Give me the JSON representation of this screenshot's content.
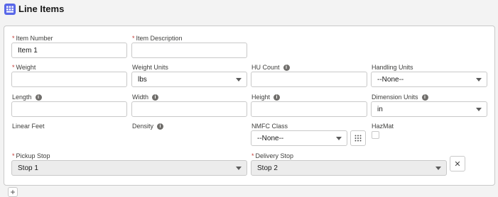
{
  "header": {
    "title": "Line Items",
    "icon": "list-icon",
    "icon_color": "#5867e8"
  },
  "fields": {
    "item_number": {
      "label": "Item Number",
      "value": "Item 1",
      "required": true
    },
    "item_description": {
      "label": "Item Description",
      "value": "",
      "required": true
    },
    "weight": {
      "label": "Weight",
      "value": "",
      "required": true
    },
    "weight_units": {
      "label": "Weight Units",
      "value": "lbs"
    },
    "hu_count": {
      "label": "HU Count",
      "value": ""
    },
    "handling_units": {
      "label": "Handling Units",
      "value": "--None--"
    },
    "length": {
      "label": "Length",
      "value": ""
    },
    "width": {
      "label": "Width",
      "value": ""
    },
    "height": {
      "label": "Height",
      "value": ""
    },
    "dimension_units": {
      "label": "Dimension Units",
      "value": "in"
    },
    "linear_feet": {
      "label": "Linear Feet"
    },
    "density": {
      "label": "Density"
    },
    "nmfc_class": {
      "label": "NMFC Class",
      "value": "--None--"
    },
    "hazmat": {
      "label": "HazMat",
      "checked": false
    },
    "pickup_stop": {
      "label": "Pickup Stop",
      "value": "Stop 1",
      "required": true
    },
    "delivery_stop": {
      "label": "Delivery Stop",
      "value": "Stop 2",
      "required": true
    }
  },
  "required_marker": "*",
  "info_glyph": "i",
  "remove_glyph": "✕",
  "add_glyph": "+"
}
